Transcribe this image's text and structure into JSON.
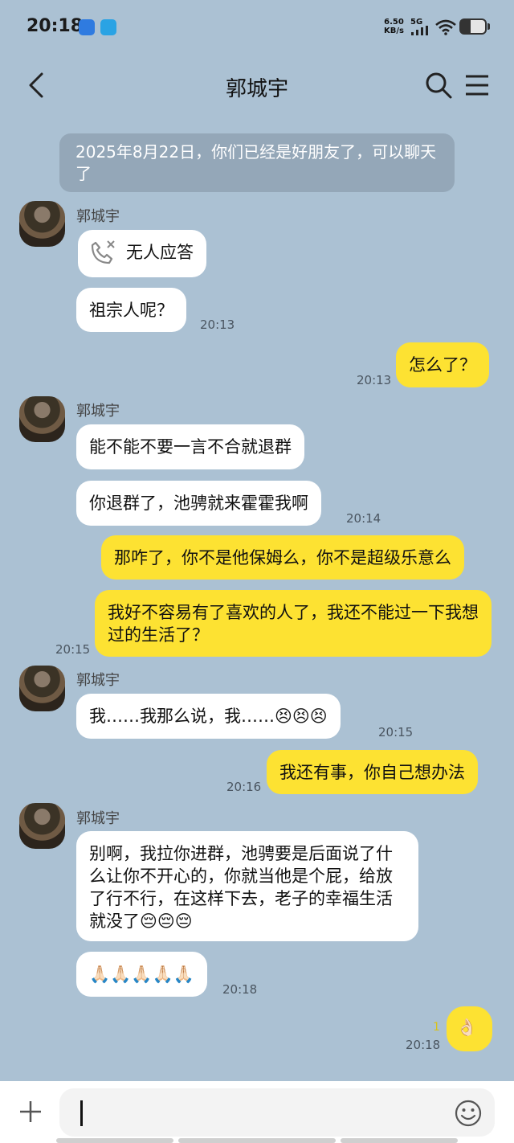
{
  "status_bar": {
    "time": "20:18",
    "net_speed": "6.50",
    "net_unit": "KB/s",
    "network": "5G"
  },
  "header": {
    "title": "郭城宇"
  },
  "system_message": "2025年8月22日，你们已经是好朋友了，可以聊天了",
  "contact_name": "郭城宇",
  "messages": [
    {
      "text": "无人应答",
      "icon": "missed-call-icon"
    },
    {
      "text": "祖宗人呢？",
      "time": "20:13"
    },
    {
      "text": "怎么了？",
      "time": "20:13"
    },
    {
      "text": "能不能不要一言不合就退群"
    },
    {
      "text": "你退群了，池骋就来霍霍我啊",
      "time": "20:14"
    },
    {
      "text": "那咋了，你不是他保姆么，你不是超级乐意么"
    },
    {
      "text": "我好不容易有了喜欢的人了，我还不能过一下我想过的生活了？",
      "time": "20:15"
    },
    {
      "text": "我……我那么说，我……😣😣😣",
      "time": "20:15"
    },
    {
      "text": "我还有事，你自己想办法",
      "time": "20:16"
    },
    {
      "text": "别啊，我拉你进群，池骋要是后面说了什么让你不开心的，你就当他是个屁，给放了行不行，在这样下去，老子的幸福生活就没了😔😔😔"
    },
    {
      "text": "🙏🏻🙏🏻🙏🏻🙏🏻🙏🏻",
      "time": "20:18"
    },
    {
      "text": "👌🏻",
      "time": "20:18",
      "unread": "1"
    }
  ],
  "colors": {
    "background": "#abc1d3",
    "outgoing_bubble": "#fde232",
    "incoming_bubble": "#ffffff"
  }
}
